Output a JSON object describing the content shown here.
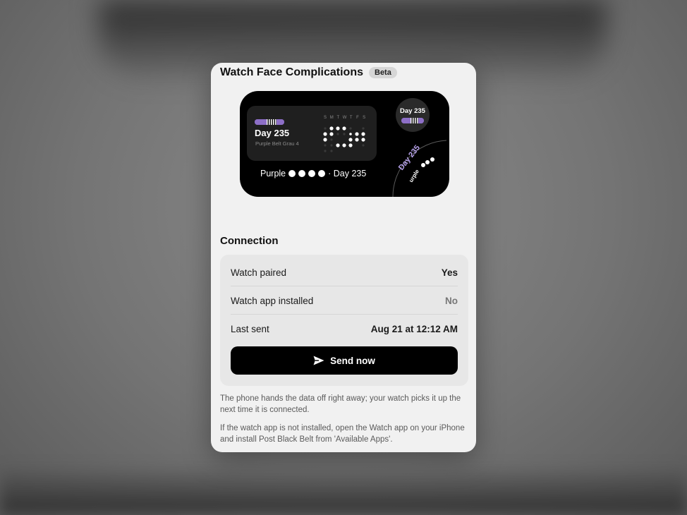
{
  "header": {
    "title": "Watch Face Complications",
    "badge": "Beta"
  },
  "preview": {
    "rect": {
      "day_label": "Day 235",
      "subtitle": "Purple Belt Grau 4",
      "weekdays": [
        "S",
        "M",
        "T",
        "W",
        "T",
        "F",
        "S"
      ],
      "belt_color": "#8d6fc7"
    },
    "circle": {
      "day_label": "Day 235"
    },
    "inline": {
      "belt_name": "Purple",
      "day_label": "· Day 235"
    },
    "corner": {
      "day_label": "Day 235",
      "belt_name": "urple"
    }
  },
  "connection": {
    "title": "Connection",
    "rows": [
      {
        "label": "Watch paired",
        "value": "Yes"
      },
      {
        "label": "Watch app installed",
        "value": "No"
      },
      {
        "label": "Last sent",
        "value": "Aug 21 at 12:12 AM"
      }
    ],
    "send_label": "Send now",
    "send_icon": "paperplane-icon"
  },
  "notes": [
    "The phone hands the data off right away; your watch picks it up the next time it is connected.",
    "If the watch app is not installed, open the Watch app on your iPhone and install Post Black Belt from 'Available Apps'."
  ]
}
